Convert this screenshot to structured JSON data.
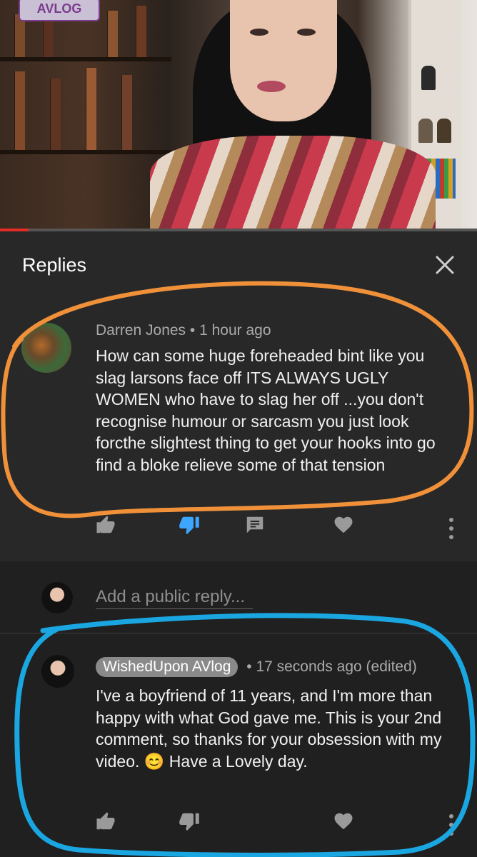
{
  "video": {
    "logo_text": "AVLOG",
    "progress_fraction": 0.06,
    "progress_color": "#e52d27"
  },
  "replies_panel": {
    "title": "Replies",
    "close_icon": "close-icon"
  },
  "parent_comment": {
    "author": "Darren Jones",
    "separator": "•",
    "time": "1 hour ago",
    "text": "How can some huge foreheaded bint like you slag larsons face off ITS ALWAYS UGLY WOMEN who have to slag her off ...you don't recognise humour or sarcasm you just look forcthe slightest thing to get your hooks into go find a bloke relieve some of that tension",
    "actions": [
      "like-icon",
      "dislike-icon",
      "reply-icon",
      "heart-icon",
      "more-icon"
    ],
    "dislike_active_color": "#3ea6ff"
  },
  "add_reply": {
    "placeholder": "Add a public reply..."
  },
  "reply_comment": {
    "author_badge": "WishedUpon AVlog",
    "separator": "•",
    "time": "17 seconds ago (edited)",
    "text": "I've a boyfriend of 11 years, and I'm more than happy with what God gave me. This is your 2nd comment, so thanks for your obsession with my video. 😊 Have a Lovely day.",
    "actions": [
      "like-icon",
      "dislike-icon",
      "heart-icon",
      "more-icon"
    ]
  },
  "colors": {
    "background": "#202020",
    "header_bg": "#282828",
    "orange_annotation": "#f0913a",
    "blue_annotation": "#1aa6e0"
  }
}
